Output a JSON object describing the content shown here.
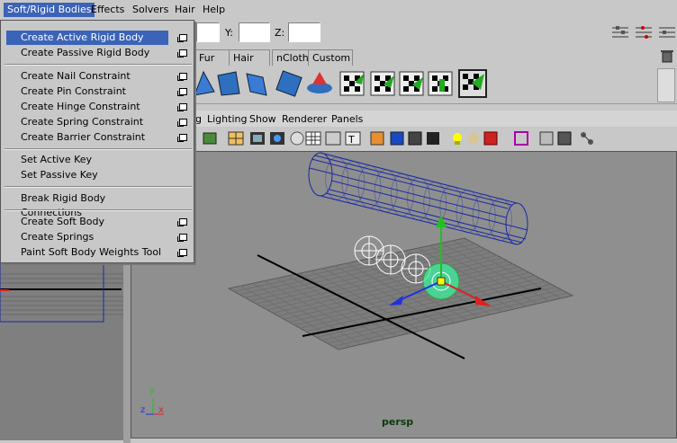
{
  "menubar": {
    "items": [
      "Soft/Rigid Bodies",
      "Effects",
      "Solvers",
      "Hair",
      "Help"
    ]
  },
  "coords": {
    "y_label": "Y:",
    "z_label": "Z:"
  },
  "shelf_tabs": [
    "Fur",
    "Hair",
    "nCloth",
    "Custom"
  ],
  "panel_menu": [
    "Lighting",
    "Show",
    "Renderer",
    "Panels"
  ],
  "panel_menu_partial": "g",
  "dropdown": {
    "items": [
      {
        "label": "Create Active Rigid Body",
        "option": true,
        "highlight": true
      },
      {
        "label": "Create Passive Rigid Body",
        "option": true
      },
      {
        "label": "Create Nail Constraint",
        "option": true
      },
      {
        "label": "Create Pin Constraint",
        "option": true
      },
      {
        "label": "Create Hinge Constraint",
        "option": true
      },
      {
        "label": "Create Spring Constraint",
        "option": true
      },
      {
        "label": "Create Barrier Constraint",
        "option": true
      },
      {
        "label": "Set Active Key",
        "option": false
      },
      {
        "label": "Set Passive Key",
        "option": false
      },
      {
        "label": "Break Rigid Body Connections",
        "option": false
      },
      {
        "label": "Create Soft Body",
        "option": true
      },
      {
        "label": "Create Springs",
        "option": true
      },
      {
        "label": "Paint Soft Body Weights Tool",
        "option": true
      }
    ]
  },
  "viewport": {
    "camera_label": "persp",
    "axis_labels": {
      "y": "y",
      "z": "z",
      "x": "x"
    },
    "colors": {
      "cylinder": "#1a2aa0",
      "selected": "#3cf0a0",
      "x_axis": "#e02020",
      "y_axis": "#20c020",
      "z_axis": "#2030e0"
    }
  },
  "icons": {
    "shelf": [
      "rigid-body-icon",
      "constraint-icon",
      "nail-icon",
      "pin-icon",
      "hinge-icon",
      "barrier-icon",
      "field-icon",
      "key-icon",
      "checker-icon",
      "checker-icon-2",
      "checker-icon-3",
      "checker-icon-4",
      "checker-icon-5"
    ],
    "panel_toolbar": [
      "camera-icon",
      "grid-icon",
      "film-icon",
      "resolution-icon",
      "safe-icon",
      "gate-icon",
      "wireframe-icon",
      "shaded-icon",
      "textured-icon",
      "light-icon",
      "default-light-icon",
      "all-lights-icon",
      "isolate-icon",
      "xray-icon",
      "hud-icon"
    ]
  }
}
